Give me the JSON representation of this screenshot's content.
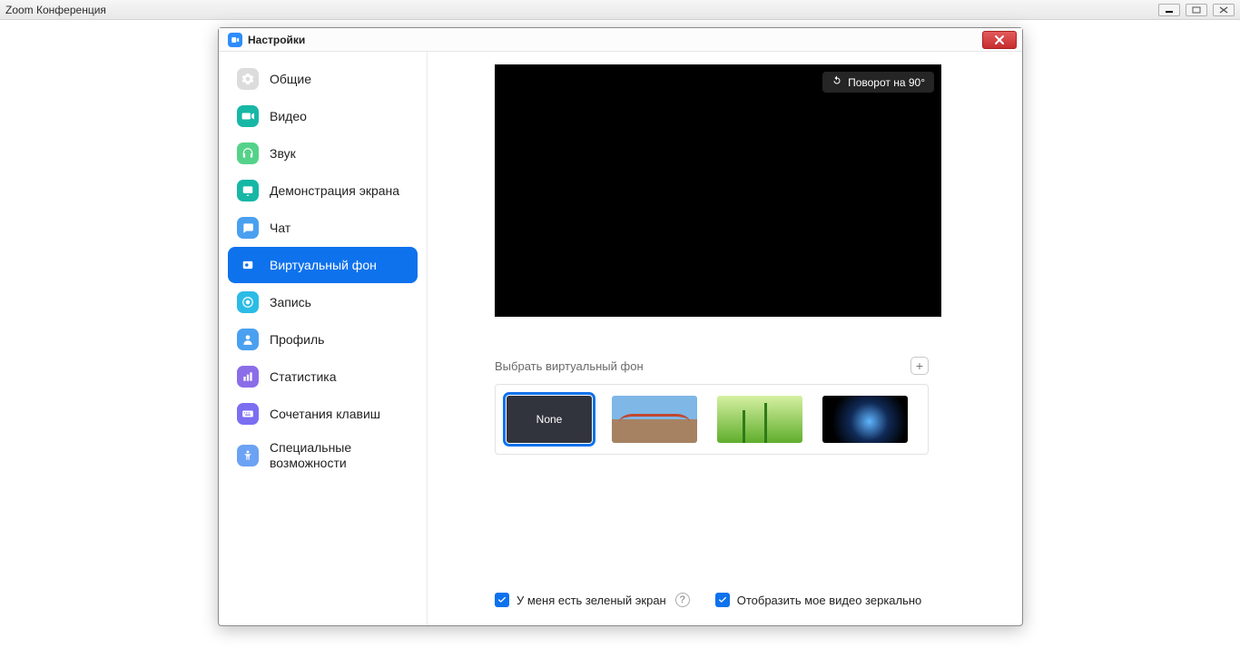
{
  "window": {
    "title": "Zoom Конференция"
  },
  "dialog": {
    "title": "Настройки"
  },
  "sidebar": {
    "items": [
      {
        "label": "Общие"
      },
      {
        "label": "Видео"
      },
      {
        "label": "Звук"
      },
      {
        "label": "Демонстрация экрана"
      },
      {
        "label": "Чат"
      },
      {
        "label": "Виртуальный фон"
      },
      {
        "label": "Запись"
      },
      {
        "label": "Профиль"
      },
      {
        "label": "Статистика"
      },
      {
        "label": "Сочетания клавиш"
      },
      {
        "label": "Специальные возможности"
      }
    ]
  },
  "preview": {
    "rotate_label": "Поворот на 90°"
  },
  "virtual_bg": {
    "choose_label": "Выбрать виртуальный фон",
    "none_label": "None"
  },
  "footer": {
    "green_screen": "У меня есть зеленый экран",
    "mirror": "Отобразить мое видео зеркально"
  }
}
